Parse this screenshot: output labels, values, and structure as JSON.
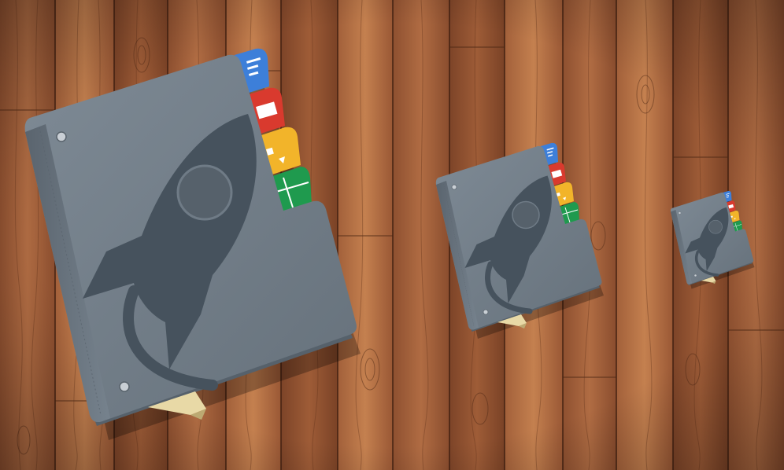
{
  "scene": {
    "background": "wood-planks",
    "colors": {
      "wood_base": "#9a5a37",
      "wood_light": "#c07a4f",
      "wood_dark": "#6d3a22",
      "cover": "#6f7b86",
      "cover_dark": "#56616b",
      "rocket": "#46525d",
      "tab_blue": "#3d7fd9",
      "tab_red": "#d93a2e",
      "tab_yellow": "#f2b42a",
      "tab_green": "#1f9a4e",
      "paper": "#f2f2ee",
      "bookmark": "#e8d9a6"
    },
    "icons": [
      {
        "name": "launchpad-binder-icon-large",
        "size_label": "large"
      },
      {
        "name": "launchpad-binder-icon-medium",
        "size_label": "medium"
      },
      {
        "name": "launchpad-binder-icon-small",
        "size_label": "small"
      }
    ]
  }
}
